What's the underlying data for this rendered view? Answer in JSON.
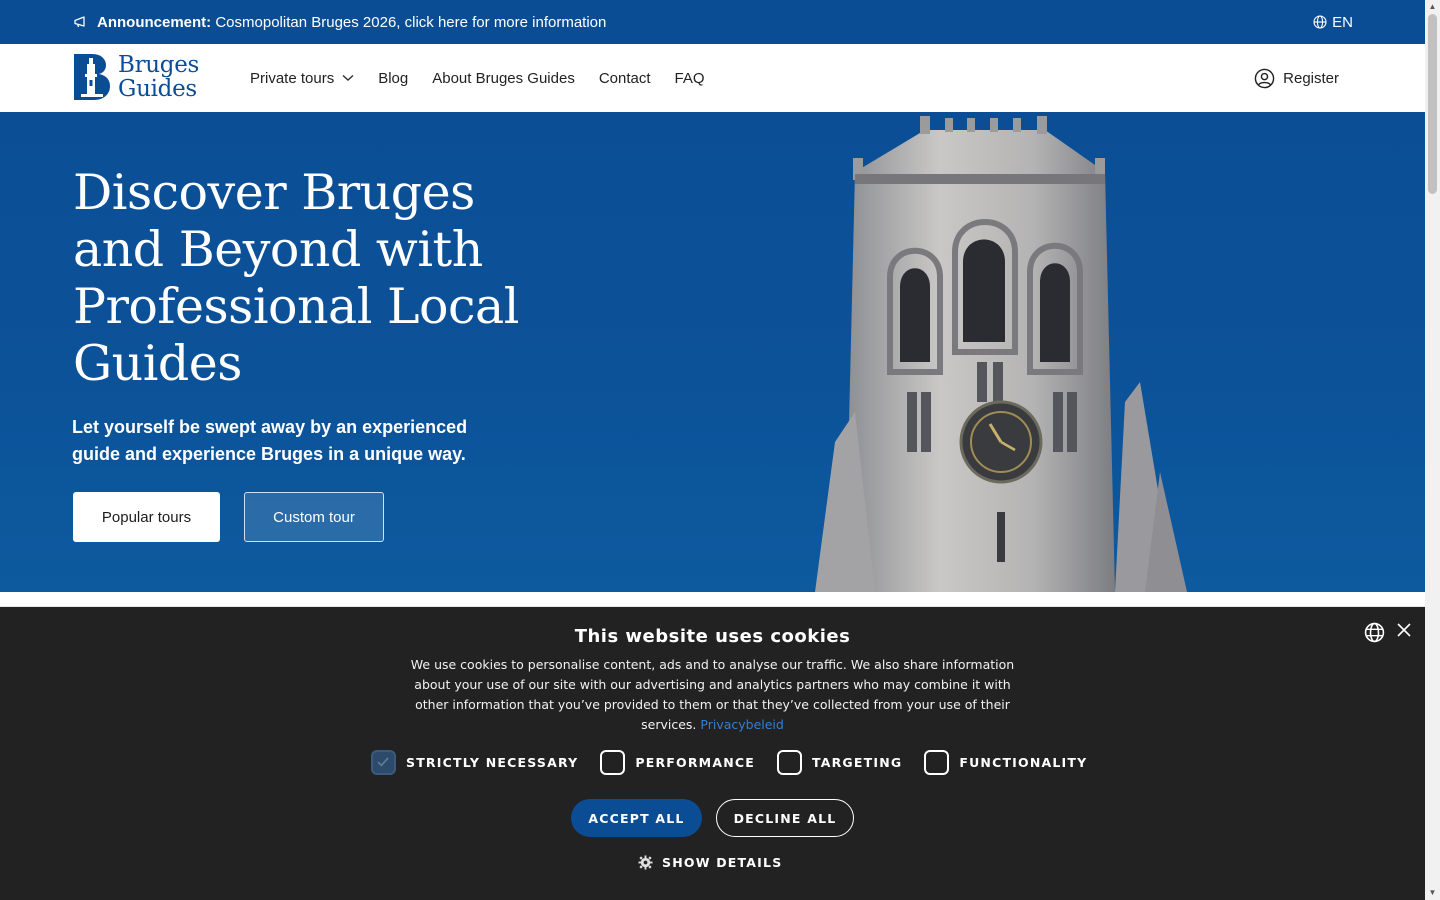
{
  "announcement": {
    "label": "Announcement:",
    "text": " Cosmopolitan Bruges 2026, click here for more information",
    "language": "EN"
  },
  "header": {
    "logo_line1": "Bruges",
    "logo_line2": "Guides",
    "nav": [
      {
        "label": "Private tours",
        "has_dropdown": true
      },
      {
        "label": "Blog"
      },
      {
        "label": "About Bruges Guides"
      },
      {
        "label": "Contact"
      },
      {
        "label": "FAQ"
      }
    ],
    "register_label": "Register"
  },
  "hero": {
    "title": "Discover Bruges and Beyond with Professional Local Guides",
    "subtitle": "Let yourself be swept away by an experienced guide and experience Bruges in a unique way.",
    "primary_button": "Popular tours",
    "secondary_button": "Custom tour"
  },
  "cookie": {
    "title": "This website uses cookies",
    "text": "We use cookies to personalise content, ads and to analyse our traffic. We also share information about your use of our site with our advertising and analytics partners who may combine it with other information that you’ve provided to them or that they’ve collected from your use of their services.",
    "link": "Privacybeleid",
    "categories": [
      {
        "label": "STRICTLY NECESSARY",
        "checked": true
      },
      {
        "label": "PERFORMANCE",
        "checked": false
      },
      {
        "label": "TARGETING",
        "checked": false
      },
      {
        "label": "FUNCTIONALITY",
        "checked": false
      }
    ],
    "accept_label": "ACCEPT ALL",
    "decline_label": "DECLINE ALL",
    "details_label": "SHOW DETAILS"
  },
  "colors": {
    "brand_blue": "#0b4d94",
    "cookie_bg": "#222222",
    "link_blue": "#2f80d8"
  },
  "icons": [
    "megaphone-icon",
    "globe-icon",
    "chevron-down-icon",
    "user-circle-icon",
    "close-icon",
    "gear-icon",
    "belfry-logo-icon"
  ]
}
